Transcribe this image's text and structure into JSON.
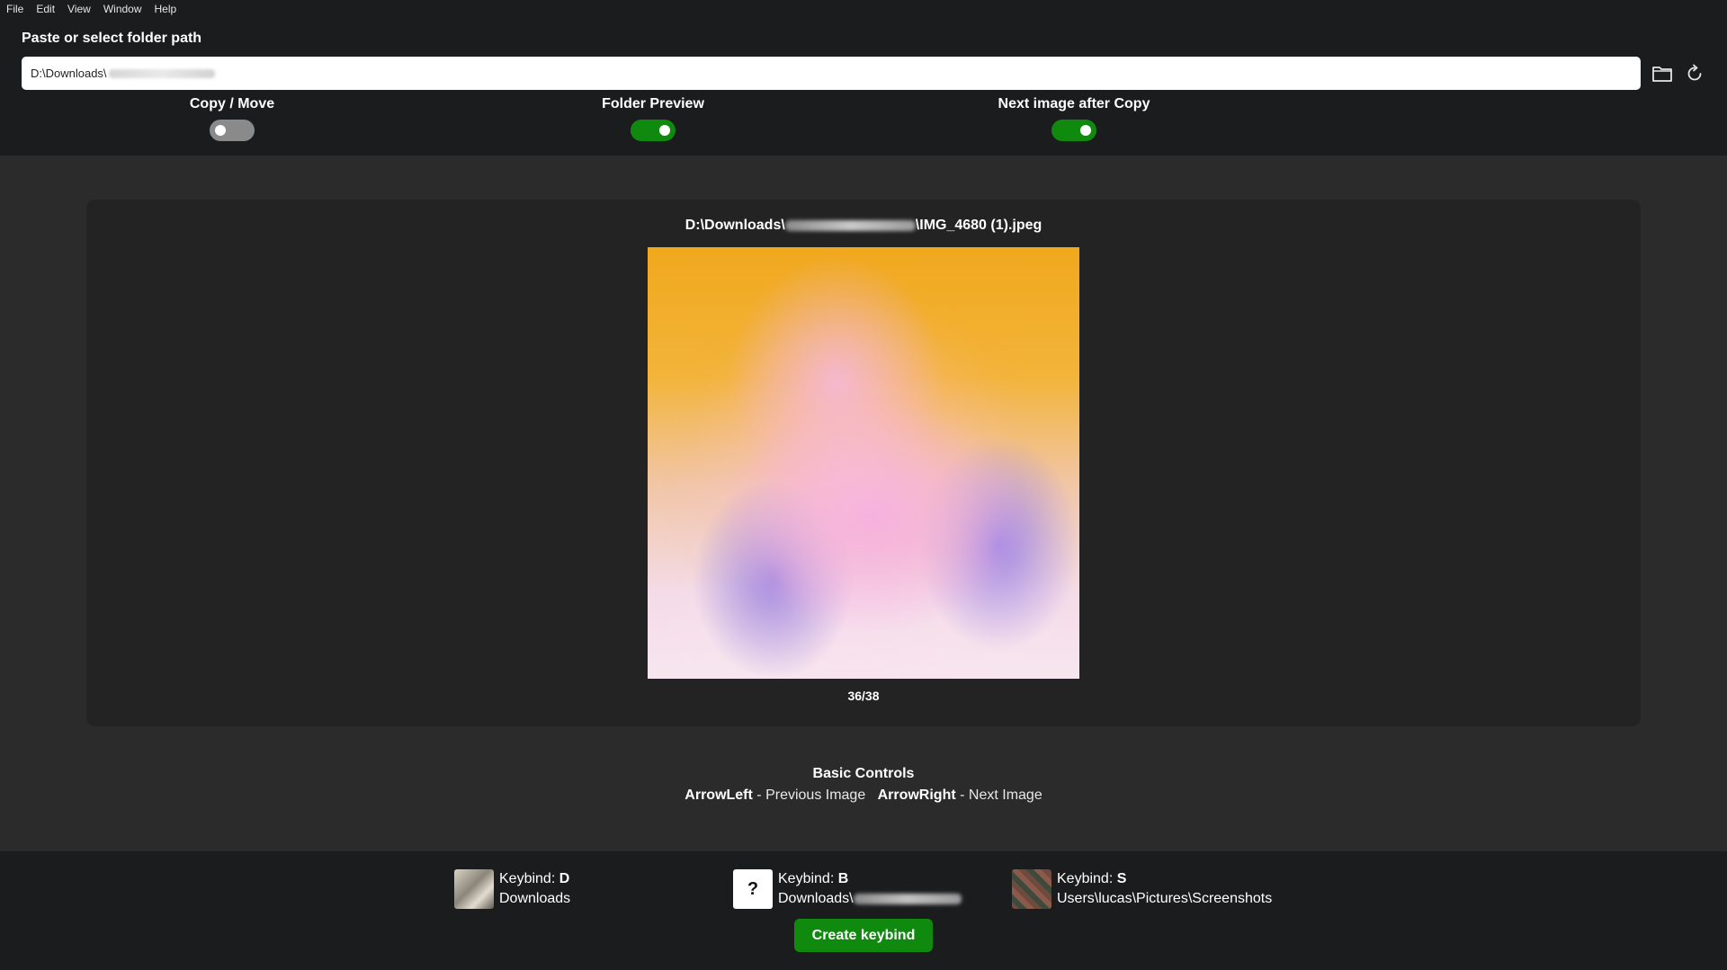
{
  "menu": {
    "items": [
      "File",
      "Edit",
      "View",
      "Window",
      "Help"
    ]
  },
  "path_section": {
    "label": "Paste or select folder path",
    "value_prefix": "D:\\Downloads\\"
  },
  "toggles": [
    {
      "label": "Copy / Move",
      "state": "off"
    },
    {
      "label": "Folder Preview",
      "state": "on"
    },
    {
      "label": "Next image after Copy",
      "state": "on"
    }
  ],
  "viewer": {
    "path_prefix": "D:\\Downloads\\",
    "path_suffix": "\\IMG_4680 (1).jpeg",
    "counter": "36/38"
  },
  "controls": {
    "title": "Basic Controls",
    "left_key": "ArrowLeft",
    "left_desc": " - Previous Image",
    "right_key": "ArrowRight",
    "right_desc": " - Next Image"
  },
  "keybinds": [
    {
      "label": "Keybind: ",
      "key": "D",
      "path": "Downloads",
      "path_blurred": false
    },
    {
      "label": "Keybind: ",
      "key": "B",
      "path": "Downloads\\",
      "path_blurred": true
    },
    {
      "label": "Keybind: ",
      "key": "S",
      "path": "Users\\lucas\\Pictures\\Screenshots",
      "path_blurred": false
    }
  ],
  "create_button": "Create keybind",
  "unknown_thumb_glyph": "?",
  "colors": {
    "accent_green": "#0f8a0f",
    "bar_bg": "#1b1c1e",
    "main_bg": "#2b2b2b",
    "panel_bg": "#232323"
  }
}
